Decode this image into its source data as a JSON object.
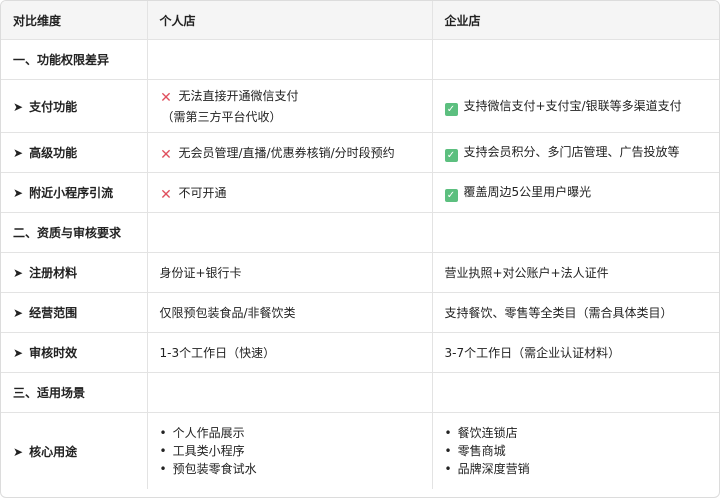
{
  "header": {
    "col1": "对比维度",
    "col2": "个人店",
    "col3": "企业店"
  },
  "sections": {
    "s1": "一、功能权限差异",
    "s2": "二、资质与审核要求",
    "s3": "三、适用场景"
  },
  "rows": {
    "payment": {
      "label": "支付功能",
      "personal": "无法直接开通微信支付",
      "personal_note": "（需第三方平台代收）",
      "enterprise": "支持微信支付+支付宝/银联等多渠道支付"
    },
    "advanced": {
      "label": "高级功能",
      "personal": "无会员管理/直播/优惠券核销/分时段预约",
      "enterprise": "支持会员积分、多门店管理、广告投放等"
    },
    "nearby": {
      "label": "附近小程序引流",
      "personal": "不可开通",
      "enterprise": "覆盖周边5公里用户曝光"
    },
    "materials": {
      "label": "注册材料",
      "personal": "身份证+银行卡",
      "enterprise": "营业执照+对公账户+法人证件"
    },
    "scope": {
      "label": "经营范围",
      "personal": "仅限预包装食品/非餐饮类",
      "enterprise": "支持餐饮、零售等全类目（需合具体类目）"
    },
    "review": {
      "label": "审核时效",
      "personal": "1-3个工作日（快速）",
      "enterprise": "3-7个工作日（需企业认证材料）"
    },
    "usage": {
      "label": "核心用途",
      "personal": [
        "个人作品展示",
        "工具类小程序",
        "预包装零食试水"
      ],
      "enterprise": [
        "餐饮连锁店",
        "零售商城",
        "品牌深度营销"
      ]
    }
  },
  "icons": {
    "arrow": "➤",
    "bullet": "•",
    "cross": "✕",
    "check": "✓"
  },
  "colors": {
    "cross": "#e0505e",
    "check": "#5cbf7f",
    "header_bg": "#f5f5f5"
  }
}
